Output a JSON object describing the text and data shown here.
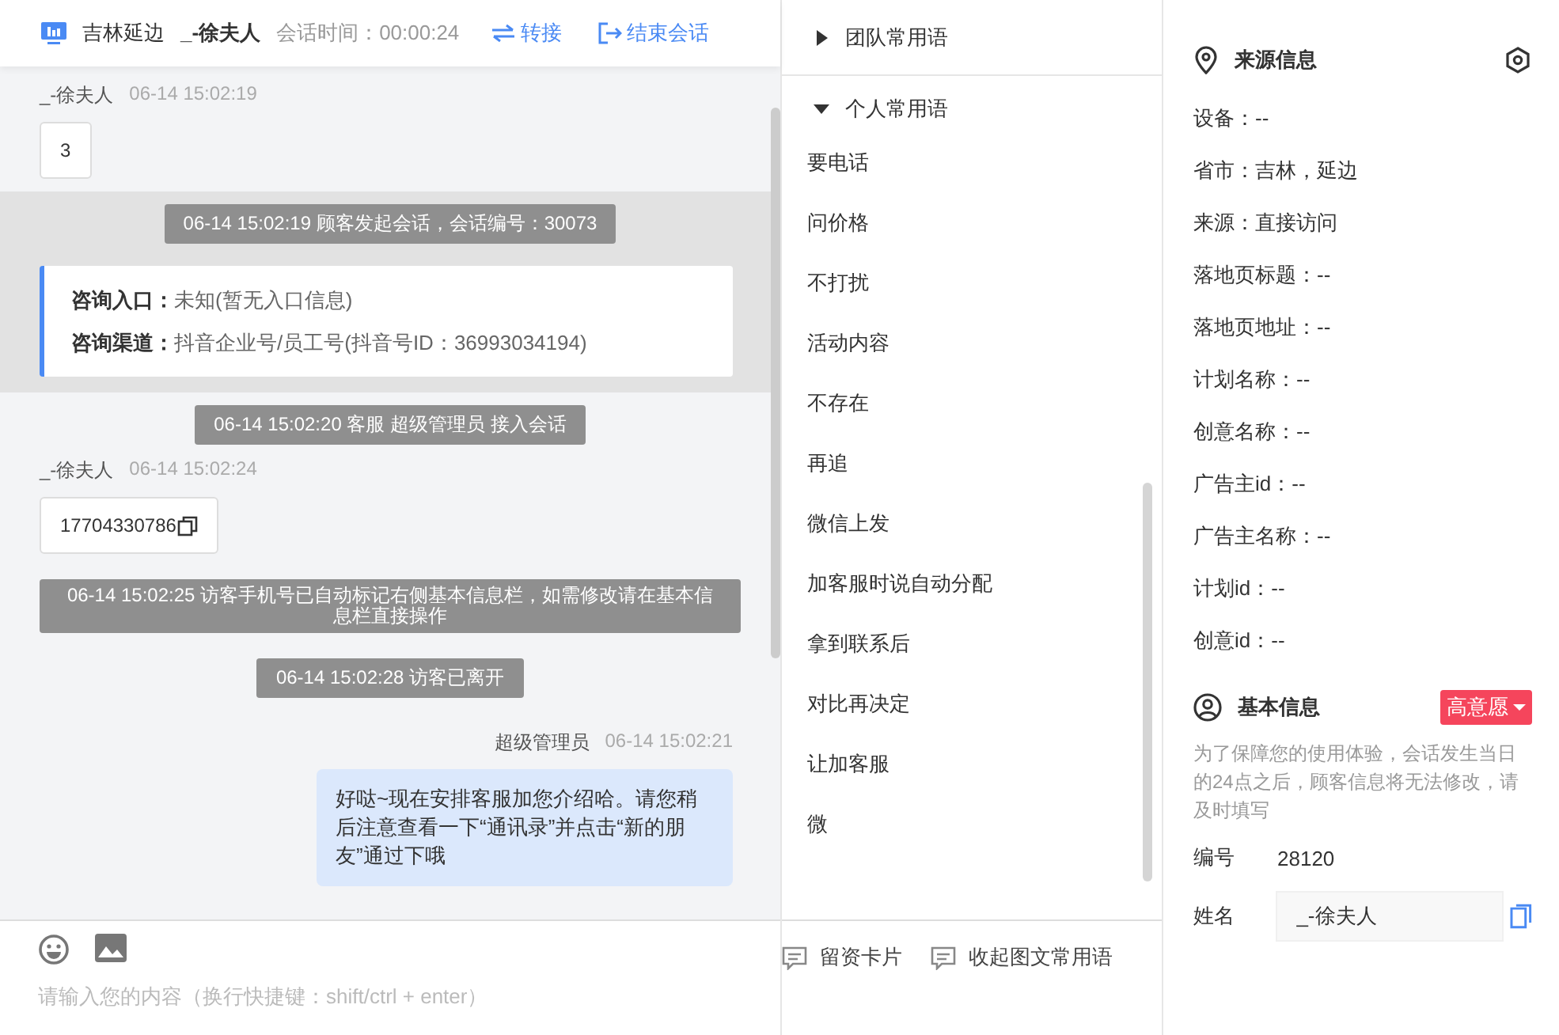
{
  "header": {
    "region": "吉林延边",
    "visitor": "_-徐夫人",
    "duration_label": "会话时间：00:00:24",
    "transfer": "转接",
    "end": "结束会话"
  },
  "messages": [
    {
      "kind": "visitor",
      "sender": "_-徐夫人",
      "time": "06-14 15:02:19",
      "text": "3"
    },
    {
      "kind": "system",
      "text": "06-14 15:02:19 顾客发起会话，会话编号：30073",
      "highlight": true
    },
    {
      "kind": "source",
      "highlight": true,
      "lines": [
        {
          "label": "咨询入口：",
          "value": "未知(暂无入口信息)"
        },
        {
          "label": "咨询渠道：",
          "value": "抖音企业号/员工号(抖音号ID：36993034194)"
        }
      ]
    },
    {
      "kind": "system",
      "text": "06-14 15:02:20 客服 超级管理员 接入会话",
      "highlight": false
    },
    {
      "kind": "visitor",
      "sender": "_-徐夫人",
      "time": "06-14 15:02:24",
      "text": "17704330786",
      "copyable": true
    },
    {
      "kind": "system",
      "text": "06-14 15:02:25 访客手机号已自动标记右侧基本信息栏，如需修改请在基本信息栏直接操作",
      "highlight": false
    },
    {
      "kind": "system",
      "text": "06-14 15:02:28 访客已离开",
      "highlight": false
    },
    {
      "kind": "agent",
      "sender": "超级管理员",
      "time": "06-14 15:02:21",
      "text": "好哒~现在安排客服加您介绍哈。请您稍后注意查看一下“通讯录”并点击“新的朋友”通过下哦"
    }
  ],
  "input": {
    "placeholder": "请输入您的内容（换行快捷键：shift/ctrl + enter）"
  },
  "phrases": {
    "groups": [
      {
        "title": "团队常用语",
        "expanded": false
      },
      {
        "title": "个人常用语",
        "expanded": true
      }
    ],
    "items": [
      "要电话",
      "问价格",
      "不打扰",
      "活动内容",
      "不存在",
      "再追",
      "微信上发",
      "加客服时说自动分配",
      "拿到联系后",
      "对比再决定",
      "让加客服",
      "微"
    ],
    "actions": [
      "留资卡片",
      "收起图文常用语"
    ]
  },
  "source_info": {
    "title": "来源信息",
    "fields": [
      "设备：--",
      "省市：吉林，延边",
      "来源：直接访问",
      "落地页标题：--",
      "落地页地址：--",
      "计划名称：--",
      "创意名称：--",
      "广告主id：--",
      "广告主名称：--",
      "计划id：--",
      "创意id：--"
    ]
  },
  "basic_info": {
    "title": "基本信息",
    "intent_tag": "高意愿",
    "note": "为了保障您的使用体验，会话发生当日的24点之后，顾客信息将无法修改，请及时填写",
    "id_label": "编号",
    "id_value": "28120",
    "name_label": "姓名",
    "name_value": "_-徐夫人"
  }
}
